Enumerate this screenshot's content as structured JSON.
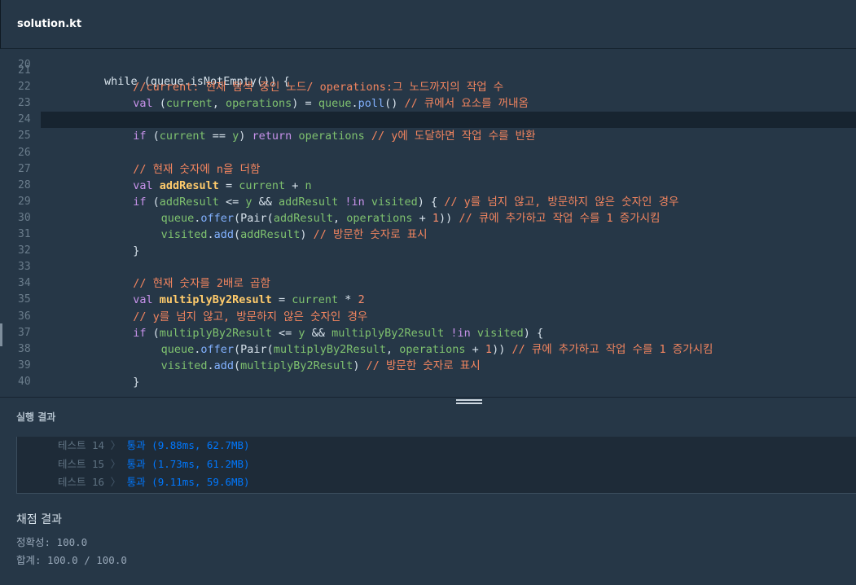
{
  "tab": {
    "title": "solution.kt"
  },
  "editor": {
    "top_partial": "while (queue.isNotEmpty()) {",
    "lines": [
      {
        "n": "21"
      },
      {
        "n": "22",
        "tokens": [
          [
            "cm",
            "//current: 현재 탐색 중인 노드/ operations:그 노드까지의 작업 수"
          ]
        ],
        "indent": 3
      },
      {
        "n": "23",
        "tokens": [
          [
            "kw",
            "val "
          ],
          [
            "op",
            "("
          ],
          [
            "var",
            "current"
          ],
          [
            "op",
            ", "
          ],
          [
            "var",
            "operations"
          ],
          [
            "op",
            ") = "
          ],
          [
            "var",
            "queue"
          ],
          [
            "op",
            "."
          ],
          [
            "fn",
            "poll"
          ],
          [
            "op",
            "() "
          ],
          [
            "cm",
            "// 큐에서 요소를 꺼내옴"
          ]
        ],
        "indent": 3
      },
      {
        "n": "24",
        "active": true
      },
      {
        "n": "25",
        "tokens": [
          [
            "kw",
            "if "
          ],
          [
            "op",
            "("
          ],
          [
            "var",
            "current"
          ],
          [
            "op",
            " == "
          ],
          [
            "var",
            "y"
          ],
          [
            "op",
            ") "
          ],
          [
            "kw",
            "return "
          ],
          [
            "var",
            "operations"
          ],
          [
            "op",
            " "
          ],
          [
            "cm",
            "// y에 도달하면 작업 수를 반환"
          ]
        ],
        "indent": 3
      },
      {
        "n": "26"
      },
      {
        "n": "27",
        "tokens": [
          [
            "cm",
            "// 현재 숫자에 n을 더함"
          ]
        ],
        "indent": 3
      },
      {
        "n": "28",
        "tokens": [
          [
            "kw",
            "val "
          ],
          [
            "bold",
            "addResult"
          ],
          [
            "op",
            " = "
          ],
          [
            "var",
            "current"
          ],
          [
            "op",
            " + "
          ],
          [
            "var",
            "n"
          ]
        ],
        "indent": 3
      },
      {
        "n": "29",
        "tokens": [
          [
            "kw",
            "if "
          ],
          [
            "op",
            "("
          ],
          [
            "var",
            "addResult"
          ],
          [
            "op",
            " <= "
          ],
          [
            "var",
            "y"
          ],
          [
            "op",
            " && "
          ],
          [
            "var",
            "addResult"
          ],
          [
            "op",
            " "
          ],
          [
            "kw",
            "!in "
          ],
          [
            "var",
            "visited"
          ],
          [
            "op",
            ") { "
          ],
          [
            "cm",
            "// y를 넘지 않고, 방문하지 않은 숫자인 경우"
          ]
        ],
        "indent": 3
      },
      {
        "n": "30",
        "tokens": [
          [
            "var",
            "queue"
          ],
          [
            "op",
            "."
          ],
          [
            "fn",
            "offer"
          ],
          [
            "op",
            "("
          ],
          [
            "op",
            "Pair"
          ],
          [
            "op",
            "("
          ],
          [
            "var",
            "addResult"
          ],
          [
            "op",
            ", "
          ],
          [
            "var",
            "operations"
          ],
          [
            "op",
            " + "
          ],
          [
            "num",
            "1"
          ],
          [
            "op",
            ")) "
          ],
          [
            "cm",
            "// 큐에 추가하고 작업 수를 1 증가시킴"
          ]
        ],
        "indent": 4
      },
      {
        "n": "31",
        "tokens": [
          [
            "var",
            "visited"
          ],
          [
            "op",
            "."
          ],
          [
            "fn",
            "add"
          ],
          [
            "op",
            "("
          ],
          [
            "var",
            "addResult"
          ],
          [
            "op",
            ") "
          ],
          [
            "cm",
            "// 방문한 숫자로 표시"
          ]
        ],
        "indent": 4
      },
      {
        "n": "32",
        "tokens": [
          [
            "op",
            "}"
          ]
        ],
        "indent": 3
      },
      {
        "n": "33"
      },
      {
        "n": "34",
        "tokens": [
          [
            "cm",
            "// 현재 숫자를 2배로 곱함"
          ]
        ],
        "indent": 3
      },
      {
        "n": "35",
        "tokens": [
          [
            "kw",
            "val "
          ],
          [
            "bold",
            "multiplyBy2Result"
          ],
          [
            "op",
            " = "
          ],
          [
            "var",
            "current"
          ],
          [
            "op",
            " * "
          ],
          [
            "num",
            "2"
          ]
        ],
        "indent": 3
      },
      {
        "n": "36",
        "tokens": [
          [
            "cm",
            "// y를 넘지 않고, 방문하지 않은 숫자인 경우"
          ]
        ],
        "indent": 3
      },
      {
        "n": "37",
        "tokens": [
          [
            "kw",
            "if "
          ],
          [
            "op",
            "("
          ],
          [
            "var",
            "multiplyBy2Result"
          ],
          [
            "op",
            " <= "
          ],
          [
            "var",
            "y"
          ],
          [
            "op",
            " && "
          ],
          [
            "var",
            "multiplyBy2Result"
          ],
          [
            "op",
            " "
          ],
          [
            "kw",
            "!in "
          ],
          [
            "var",
            "visited"
          ],
          [
            "op",
            ") {"
          ]
        ],
        "indent": 3
      },
      {
        "n": "38",
        "tokens": [
          [
            "var",
            "queue"
          ],
          [
            "op",
            "."
          ],
          [
            "fn",
            "offer"
          ],
          [
            "op",
            "("
          ],
          [
            "op",
            "Pair"
          ],
          [
            "op",
            "("
          ],
          [
            "var",
            "multiplyBy2Result"
          ],
          [
            "op",
            ", "
          ],
          [
            "var",
            "operations"
          ],
          [
            "op",
            " + "
          ],
          [
            "num",
            "1"
          ],
          [
            "op",
            ")) "
          ],
          [
            "cm",
            "// 큐에 추가하고 작업 수를 1 증가시킴"
          ]
        ],
        "indent": 4
      },
      {
        "n": "39",
        "tokens": [
          [
            "var",
            "visited"
          ],
          [
            "op",
            "."
          ],
          [
            "fn",
            "add"
          ],
          [
            "op",
            "("
          ],
          [
            "var",
            "multiplyBy2Result"
          ],
          [
            "op",
            ") "
          ],
          [
            "cm",
            "// 방문한 숫자로 표시"
          ]
        ],
        "indent": 4
      },
      {
        "n": "40",
        "tokens": [
          [
            "op",
            "}"
          ]
        ],
        "indent": 3
      }
    ]
  },
  "results": {
    "title": "실행 결과",
    "tests": [
      {
        "name": "테스트 14",
        "sep": "〉",
        "result": "통과 (9.88ms, 62.7MB)"
      },
      {
        "name": "테스트 15",
        "sep": "〉",
        "result": "통과 (1.73ms, 61.2MB)"
      },
      {
        "name": "테스트 16",
        "sep": "〉",
        "result": "통과 (9.11ms, 59.6MB)"
      }
    ]
  },
  "grading": {
    "title": "채점 결과",
    "accuracy": "정확성: 100.0",
    "total": "합계: 100.0 / 100.0"
  }
}
